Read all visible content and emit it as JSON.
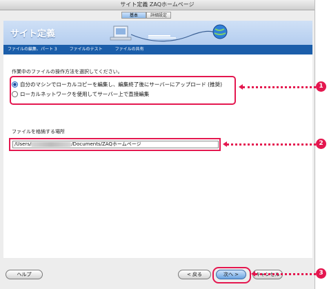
{
  "window": {
    "title": "サイト定義 ZAQホームページ"
  },
  "tabs": [
    {
      "label": "基本",
      "active": true
    },
    {
      "label": "詳細設定",
      "active": false
    }
  ],
  "header": {
    "title": "サイト定義",
    "steps": [
      "ファイルの編集、パート 3",
      "ファイルのテスト",
      "ファイルの共有"
    ]
  },
  "content": {
    "instruction": "作業中のファイルの操作方法を選択してください。",
    "options": [
      {
        "label": "自分のマシンでローカルコピーを編集し、編集終了後にサーバーにアップロード (推奨)",
        "selected": true
      },
      {
        "label": "ローカルネットワークを使用してサーバー上で直接編集",
        "selected": false
      }
    ],
    "path_label": "ファイルを格納する場所",
    "path_prefix": "/Users/",
    "path_suffix": "/Documents/ZAQホームページ"
  },
  "buttons": {
    "help": "ヘルプ",
    "back": "< 戻る",
    "next": "次へ >",
    "cancel": "キャンセル"
  },
  "callouts": [
    "1",
    "2",
    "3"
  ],
  "colors": {
    "highlight": "#e4174f",
    "header_bar": "#1b5eaa"
  }
}
